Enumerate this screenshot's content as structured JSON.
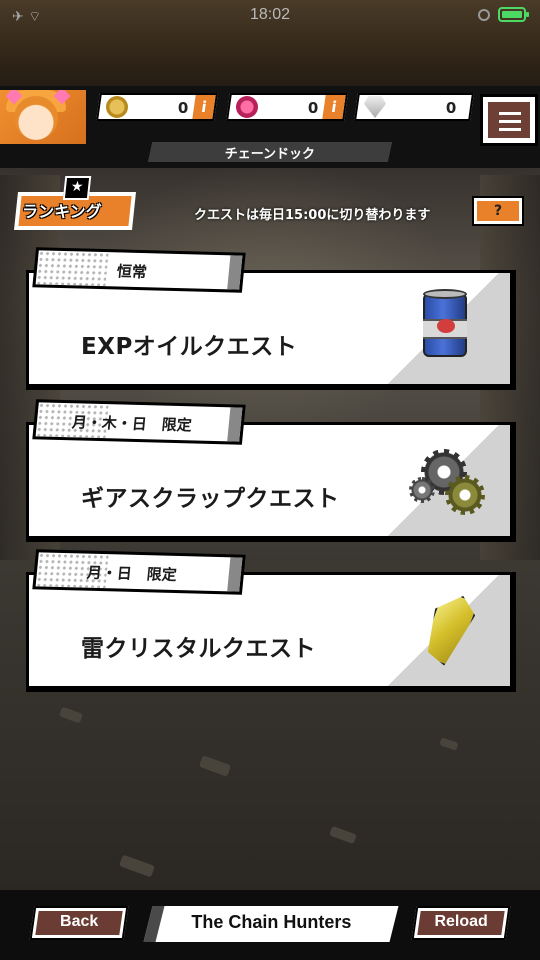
{
  "status_bar": {
    "time": "18:02"
  },
  "header": {
    "currencies": [
      {
        "icon": "gold-coin-icon",
        "value": "0",
        "info_label": "i"
      },
      {
        "icon": "pink-gem-icon",
        "value": "0",
        "info_label": "i"
      },
      {
        "icon": "diamond-icon",
        "value": "0"
      }
    ],
    "location": "チェーンドック"
  },
  "ranking": {
    "label": "ランキング"
  },
  "notice": "クエストは毎日15:00に切り替わります",
  "help_label": "?",
  "quests": [
    {
      "tag": "恒常",
      "title": "EXPオイルクエスト",
      "icon": "oil-barrel-icon"
    },
    {
      "tag": "月・木・日　限定",
      "title": "ギアスクラップクエスト",
      "icon": "gears-icon"
    },
    {
      "tag": "月・日　限定",
      "title": "雷クリスタルクエスト",
      "icon": "yellow-crystal-icon"
    }
  ],
  "bottom_bar": {
    "back_label": "Back",
    "app_title": "The Chain Hunters",
    "reload_label": "Reload"
  },
  "colors": {
    "accent_orange": "#e9812a",
    "button_brown": "#6a3c33",
    "status_green": "#4cd964"
  }
}
